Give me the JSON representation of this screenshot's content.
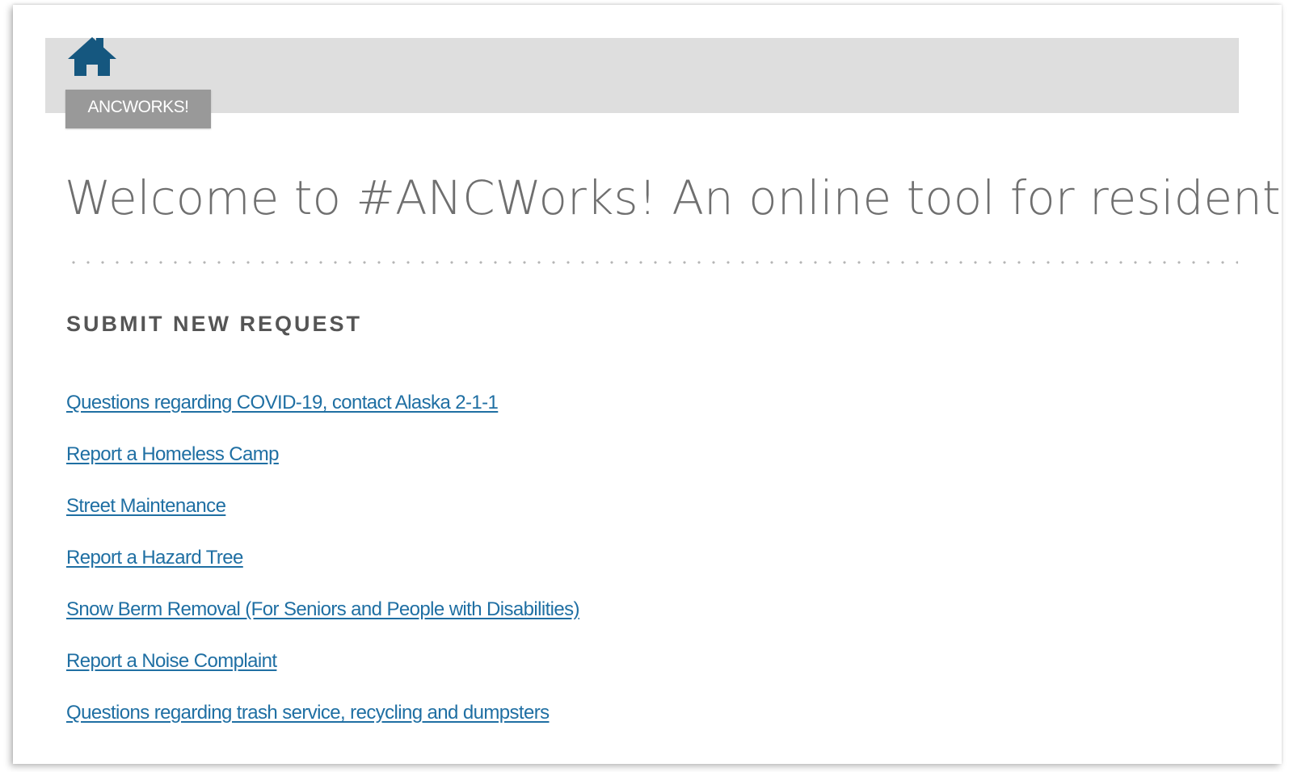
{
  "header": {
    "home_icon": "home-icon",
    "breadcrumb_label": "ANCWORKS!"
  },
  "main": {
    "title": "Welcome to #ANCWorks! An online tool for residents",
    "section_heading": "SUBMIT NEW REQUEST",
    "links": [
      {
        "label": "Questions regarding COVID-19, contact Alaska 2-1-1"
      },
      {
        "label": "Report a Homeless Camp"
      },
      {
        "label": "Street Maintenance"
      },
      {
        "label": "Report a Hazard Tree"
      },
      {
        "label": "Snow Berm Removal (For Seniors and People with Disabilities)"
      },
      {
        "label": "Report a Noise Complaint"
      },
      {
        "label": "Questions regarding trash service, recycling and dumpsters"
      }
    ]
  },
  "colors": {
    "link": "#1f6fa3",
    "home_icon": "#15577f",
    "header_band": "#dedede",
    "breadcrumb_bg": "#999999"
  }
}
